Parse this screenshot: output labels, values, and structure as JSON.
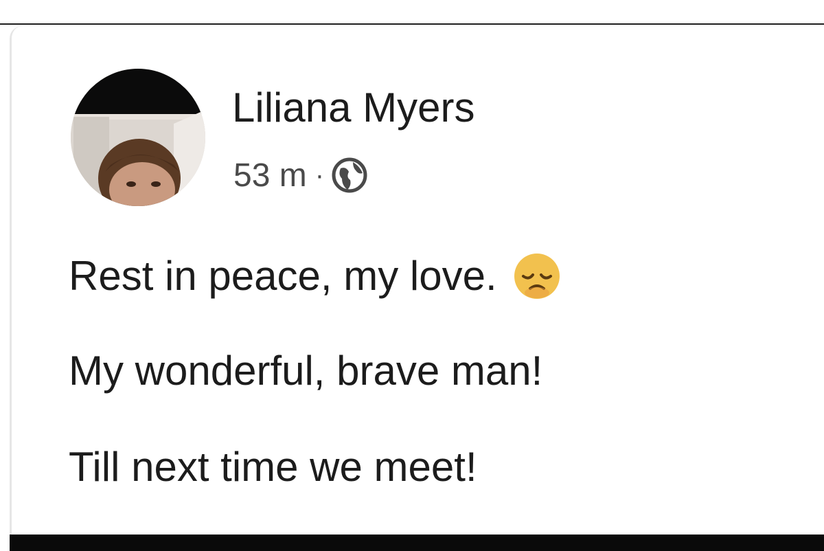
{
  "post": {
    "author": "Liliana Myers",
    "time": "53 m",
    "separator": "·",
    "audience_icon": "globe-icon",
    "lines": [
      "Rest in peace, my love.",
      "My wonderful, brave man!",
      "Till next time we meet!"
    ],
    "emoji_icon": "disappointed-face-icon"
  },
  "colors": {
    "text": "#1c1c1c",
    "meta": "#4a4a4a",
    "divider": "#1f1f1f",
    "bottom_bar": "#0a0a0a",
    "emoji": "#f2c14e"
  }
}
